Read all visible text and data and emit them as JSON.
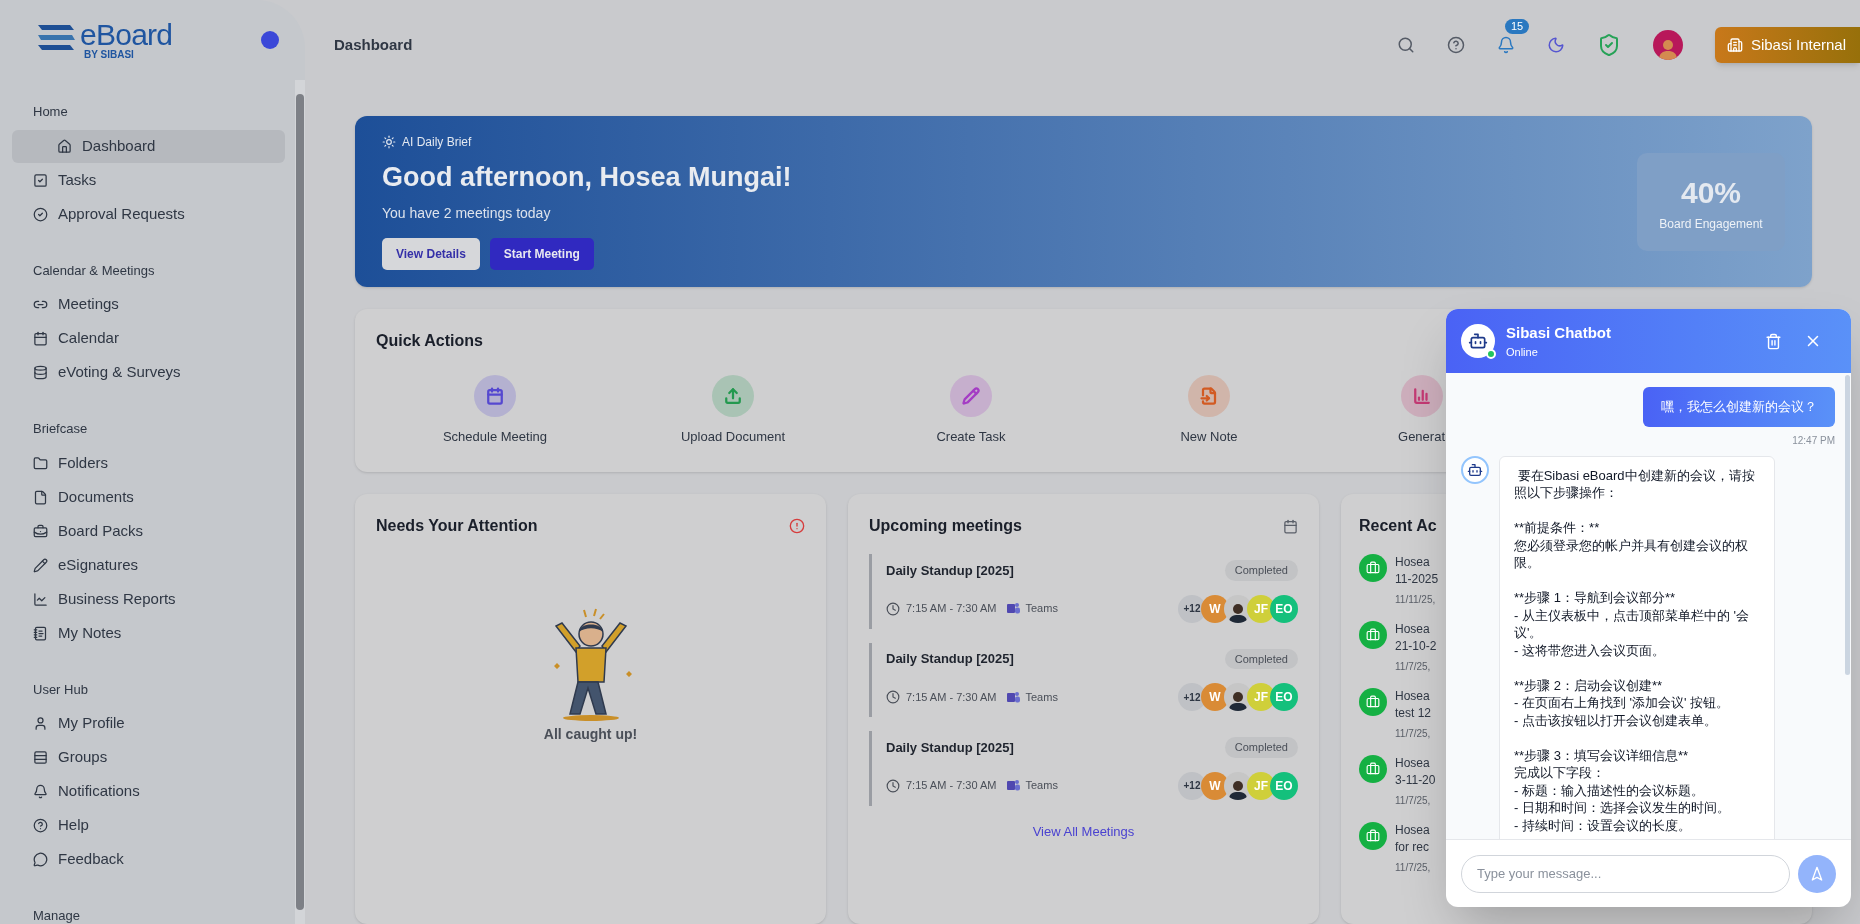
{
  "sidebar": {
    "logo": {
      "name": "eBoard",
      "tagline": "BY SIBASI"
    },
    "sections": [
      {
        "title": "Home",
        "items": [
          {
            "label": "Dashboard",
            "selected": true
          },
          {
            "label": "Tasks",
            "selected": false
          },
          {
            "label": "Approval Requests",
            "selected": false
          }
        ]
      },
      {
        "title": "Calendar & Meetings",
        "items": [
          {
            "label": "Meetings",
            "selected": false
          },
          {
            "label": "Calendar",
            "selected": false
          },
          {
            "label": "eVoting & Surveys",
            "selected": false
          }
        ]
      },
      {
        "title": "Briefcase",
        "items": [
          {
            "label": "Folders",
            "selected": false
          },
          {
            "label": "Documents",
            "selected": false
          },
          {
            "label": "Board Packs",
            "selected": false
          },
          {
            "label": "eSignatures",
            "selected": false
          },
          {
            "label": "Business Reports",
            "selected": false
          },
          {
            "label": "My Notes",
            "selected": false
          }
        ]
      },
      {
        "title": "User Hub",
        "items": [
          {
            "label": "My Profile",
            "selected": false
          },
          {
            "label": "Groups",
            "selected": false
          },
          {
            "label": "Notifications",
            "selected": false
          },
          {
            "label": "Help",
            "selected": false
          },
          {
            "label": "Feedback",
            "selected": false
          }
        ]
      },
      {
        "title": "Manage"
      }
    ]
  },
  "header": {
    "title": "Dashboard",
    "notifications_count": "15",
    "organization": "Sibasi Internal"
  },
  "brief": {
    "label": "AI Daily Brief",
    "greeting": "Good afternoon, Hosea Mungai!",
    "subtitle": "You have 2 meetings today",
    "buttons": [
      "View Details",
      "Start Meeting"
    ],
    "stat": {
      "value": "40%",
      "label": "Board Engagement"
    }
  },
  "quick_actions": {
    "title": "Quick Actions",
    "items": [
      {
        "label": "Schedule Meeting",
        "color": "#5548d0"
      },
      {
        "label": "Upload Document",
        "color": "#23994f"
      },
      {
        "label": "Create Task",
        "color": "#a43cc4"
      },
      {
        "label": "New Note",
        "color": "#d25a22"
      },
      {
        "label": "Generat",
        "color": "#c43a74"
      }
    ]
  },
  "attention": {
    "title": "Needs Your Attention",
    "empty_text": "All caught up!"
  },
  "meetings": {
    "title": "Upcoming meetings",
    "link": "View All Meetings",
    "items": [
      {
        "title": "Daily Standup [2025]",
        "time": "7:15 AM - 7:30 AM",
        "platform": "Teams",
        "status": "Completed",
        "attendees": [
          {
            "kind": "count",
            "text": "+12",
            "color": "#bfc1c5"
          },
          {
            "kind": "initials",
            "text": "W",
            "color": "#d98b36"
          },
          {
            "kind": "photo"
          },
          {
            "kind": "initials",
            "text": "JF",
            "color": "#cfcf3a"
          },
          {
            "kind": "initials",
            "text": "EO",
            "color": "#14c07c"
          }
        ]
      },
      {
        "title": "Daily Standup [2025]",
        "time": "7:15 AM - 7:30 AM",
        "platform": "Teams",
        "status": "Completed",
        "attendees": [
          {
            "kind": "count",
            "text": "+12",
            "color": "#bfc1c5"
          },
          {
            "kind": "initials",
            "text": "W",
            "color": "#d98b36"
          },
          {
            "kind": "photo"
          },
          {
            "kind": "initials",
            "text": "JF",
            "color": "#cfcf3a"
          },
          {
            "kind": "initials",
            "text": "EO",
            "color": "#14c07c"
          }
        ]
      },
      {
        "title": "Daily Standup [2025]",
        "time": "7:15 AM - 7:30 AM",
        "platform": "Teams",
        "status": "Completed",
        "attendees": [
          {
            "kind": "count",
            "text": "+12",
            "color": "#bfc1c5"
          },
          {
            "kind": "initials",
            "text": "W",
            "color": "#d98b36"
          },
          {
            "kind": "photo"
          },
          {
            "kind": "initials",
            "text": "JF",
            "color": "#cfcf3a"
          },
          {
            "kind": "initials",
            "text": "EO",
            "color": "#14c07c"
          }
        ]
      }
    ]
  },
  "recent_activity": {
    "title": "Recent Ac",
    "items": [
      {
        "lines": [
          "Hosea",
          "11-2025"
        ],
        "time": "11/11/25,"
      },
      {
        "lines": [
          "Hosea",
          "21-10-2"
        ],
        "time": "11/7/25,"
      },
      {
        "lines": [
          "Hosea",
          "test 12"
        ],
        "time": "11/7/25,"
      },
      {
        "lines": [
          "Hosea",
          "3-11-20"
        ],
        "time": "11/7/25,"
      },
      {
        "lines": [
          "Hosea",
          "for rec"
        ],
        "time": "11/7/25,"
      }
    ]
  },
  "chat": {
    "title": "Sibasi Chatbot",
    "status": "Online",
    "online": true,
    "input_placeholder": "Type your message...",
    "messages": [
      {
        "kind": "user",
        "text": "嘿，我怎么创建新的会议？",
        "time": "12:47 PM"
      },
      {
        "kind": "bot",
        "text": " 要在Sibasi eBoard中创建新的会议，请按照以下步骤操作：\n\n**前提条件：**\n您必须登录您的帐户并具有创建会议的权限。\n\n**步骤 1：导航到会议部分**\n- 从主仪表板中，点击顶部菜单栏中的 '会议'。\n- 这将带您进入会议页面。\n\n**步骤 2：启动会议创建**\n- 在页面右上角找到 '添加会议' 按钮。\n- 点击该按钮以打开会议创建表单。\n\n**步骤 3：填写会议详细信息**\n完成以下字段：\n- 标题：输入描述性的会议标题。\n- 日期和时间：选择会议发生的时间。\n- 持续时间：设置会议的长度。"
      }
    ]
  }
}
